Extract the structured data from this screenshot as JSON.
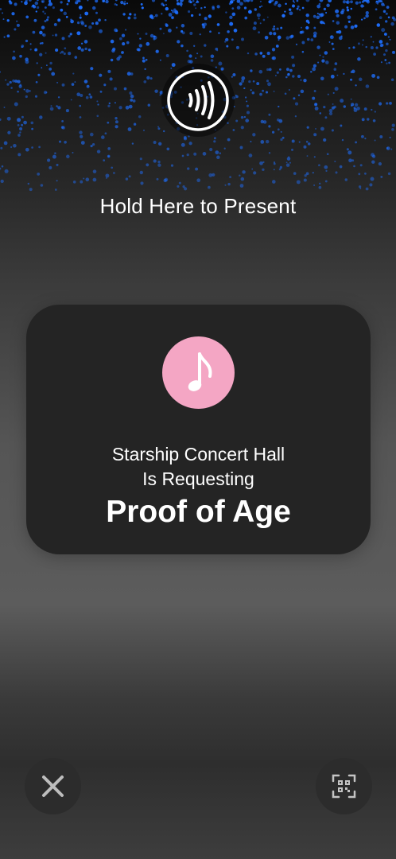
{
  "header": {
    "icon": "nfc-contactless-icon",
    "instruction": "Hold Here to Present"
  },
  "request_card": {
    "app_icon": "music-note-icon",
    "app_icon_color": "#f4a6c4",
    "requester": "Starship Concert Hall",
    "requesting_label": "Is Requesting",
    "request_type": "Proof of Age"
  },
  "controls": {
    "close_icon": "close-icon",
    "qr_icon": "qr-code-scan-icon"
  },
  "colors": {
    "particles": "#1e6fff",
    "card_background": "#242424",
    "button_background": "#2c2c2c"
  }
}
